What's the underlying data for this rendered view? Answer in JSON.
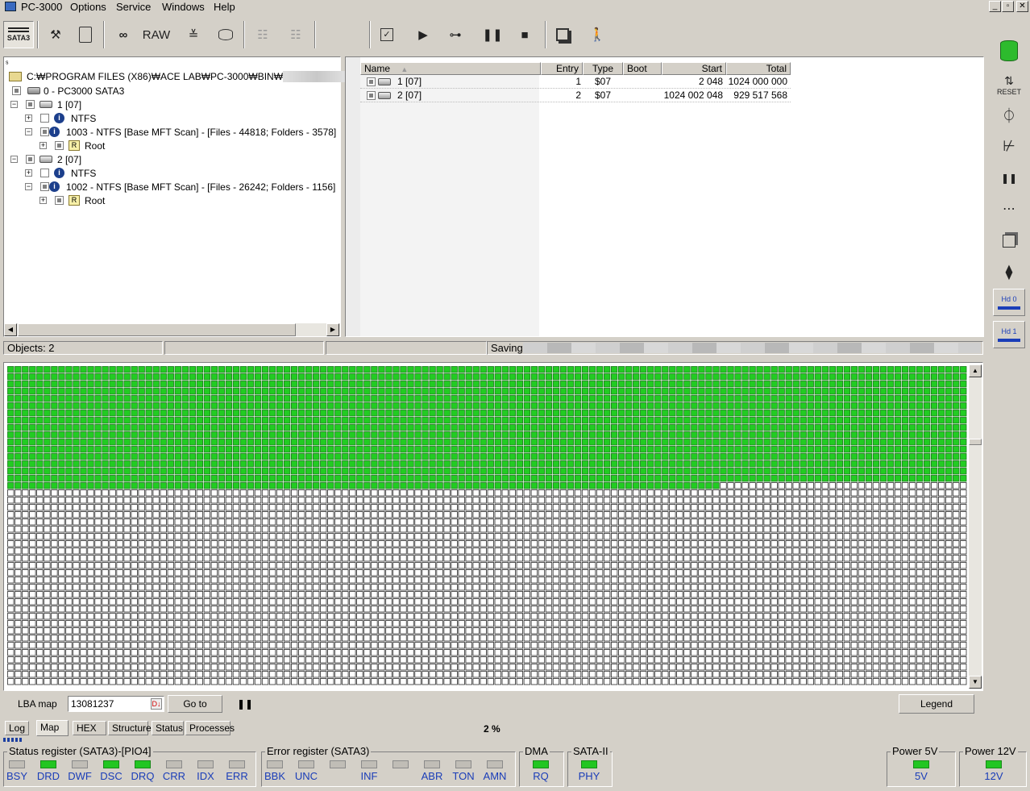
{
  "menu": {
    "app_title": "PC-3000",
    "items": [
      "Options",
      "Service",
      "Windows",
      "Help"
    ],
    "window_controls": [
      "_",
      "▫",
      "✕"
    ]
  },
  "toolbar": {
    "sata_label": "SATA3",
    "raw_label": "RAW"
  },
  "tree": {
    "path": "C:₩PROGRAM FILES (X86)₩ACE LAB₩PC-3000₩BIN₩",
    "path_tail": "₩",
    "rows": [
      {
        "label": "0 - PC3000 SATA3"
      },
      {
        "label": "1 [07]"
      },
      {
        "label": "NTFS"
      },
      {
        "label": "1003 - NTFS [Base MFT Scan] - [Files - 44818; Folders - 3578]"
      },
      {
        "label": "Root"
      },
      {
        "label": "2 [07]"
      },
      {
        "label": "NTFS"
      },
      {
        "label": "1002 - NTFS [Base MFT Scan] - [Files - 26242; Folders - 1156]"
      },
      {
        "label": "Root"
      }
    ],
    "root_icon_letter": "R"
  },
  "partitions": {
    "columns": [
      "Name",
      "Entry",
      "Type",
      "Boot",
      "Start",
      "Total"
    ],
    "rows": [
      {
        "name": "1 [07]",
        "entry": "1",
        "type": "$07",
        "boot": "",
        "start": "2 048",
        "total": "1024 000 000"
      },
      {
        "name": "2 [07]",
        "entry": "2",
        "type": "$07",
        "boot": "",
        "start": "1024 002 048",
        "total": "929 517 568"
      }
    ]
  },
  "status": {
    "objects": "Objects: 2",
    "saving": "Saving"
  },
  "map": {
    "columns": 132,
    "rows": 44,
    "filled_full_rows": 16,
    "filled_partial_cells": 98,
    "fill_color": "#22cc22",
    "lba_label": "LBA map",
    "lba_value": "13081237",
    "goto_label": "Go to",
    "legend_label": "Legend",
    "progress": "2 %"
  },
  "tabs": [
    "Log",
    "Map",
    "HEX",
    "Structure",
    "Status",
    "Processes"
  ],
  "active_tab": "Map",
  "status_register": {
    "title": "Status register (SATA3)-[PIO4]",
    "flags": [
      {
        "label": "BSY",
        "on": false
      },
      {
        "label": "DRD",
        "on": true
      },
      {
        "label": "DWF",
        "on": false
      },
      {
        "label": "DSC",
        "on": true
      },
      {
        "label": "DRQ",
        "on": true
      },
      {
        "label": "CRR",
        "on": false
      },
      {
        "label": "IDX",
        "on": false
      },
      {
        "label": "ERR",
        "on": false
      }
    ]
  },
  "error_register": {
    "title": "Error register (SATA3)",
    "flags": [
      {
        "label": "BBK",
        "on": false
      },
      {
        "label": "UNC",
        "on": false
      },
      {
        "label": "",
        "on": false
      },
      {
        "label": "INF",
        "on": false
      },
      {
        "label": "",
        "on": false
      },
      {
        "label": "ABR",
        "on": false
      },
      {
        "label": "TON",
        "on": false
      },
      {
        "label": "AMN",
        "on": false
      }
    ]
  },
  "dma": {
    "title": "DMA",
    "label": "RQ",
    "on": true
  },
  "sata2": {
    "title": "SATA-II",
    "label": "PHY",
    "on": true
  },
  "power5": {
    "title": "Power 5V",
    "label": "5V",
    "on": true
  },
  "power12": {
    "title": "Power 12V",
    "label": "12V",
    "on": true
  },
  "rightbar": {
    "reset_label": "RESET",
    "hd0_label": "Hd 0",
    "hd1_label": "Hd 1"
  }
}
